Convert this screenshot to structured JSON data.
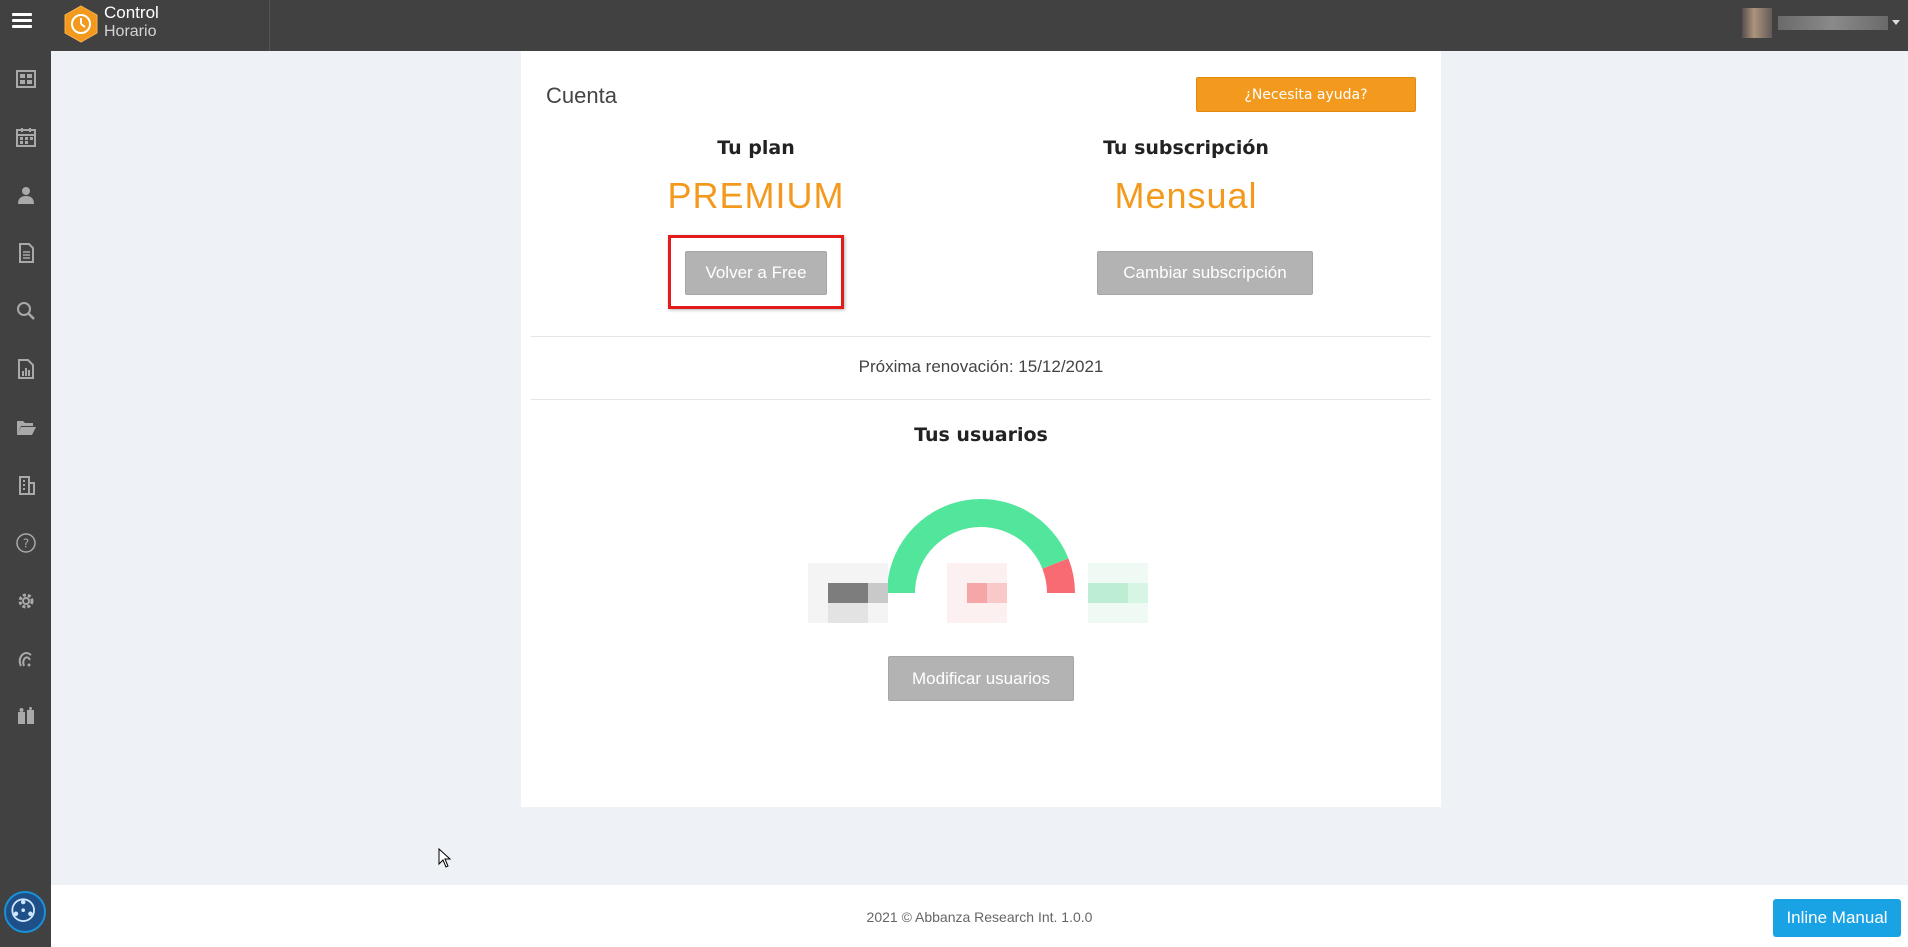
{
  "app": {
    "logo_line1": "Control",
    "logo_line2": "Horario"
  },
  "sidebar": {
    "items": [
      {
        "icon": "dashboard-icon"
      },
      {
        "icon": "calendar-icon"
      },
      {
        "icon": "user-icon"
      },
      {
        "icon": "document-icon"
      },
      {
        "icon": "search-icon"
      },
      {
        "icon": "report-icon"
      },
      {
        "icon": "folder-open-icon"
      },
      {
        "icon": "building-icon"
      },
      {
        "icon": "help-icon"
      },
      {
        "icon": "gear-icon"
      },
      {
        "icon": "fingerprint-icon"
      },
      {
        "icon": "people-icon"
      }
    ]
  },
  "account": {
    "title": "Cuenta",
    "help_label": "¿Necesita ayuda?",
    "plan_heading": "Tu plan",
    "plan_value": "PREMIUM",
    "downgrade_label": "Volver a Free",
    "subscription_heading": "Tu subscripción",
    "subscription_value": "Mensual",
    "change_subscription_label": "Cambiar subscripción",
    "renewal_text": "Próxima renovación: 15/12/2021",
    "users_heading": "Tus usuarios",
    "modify_users_label": "Modificar usuarios",
    "gauge": {
      "used_fraction": 0.88,
      "used_color": "#52e59c",
      "warning_color": "#f96b73"
    }
  },
  "footer": {
    "copyright": "2021 © Abbanza Research Int. 1.0.0"
  },
  "inline_manual": {
    "label": "Inline Manual"
  },
  "colors": {
    "accent": "#f39a1e",
    "topbar": "#414141",
    "button_gray": "#b3b3b3",
    "highlight": "#e21b1b",
    "inline_manual": "#19a2e4"
  }
}
